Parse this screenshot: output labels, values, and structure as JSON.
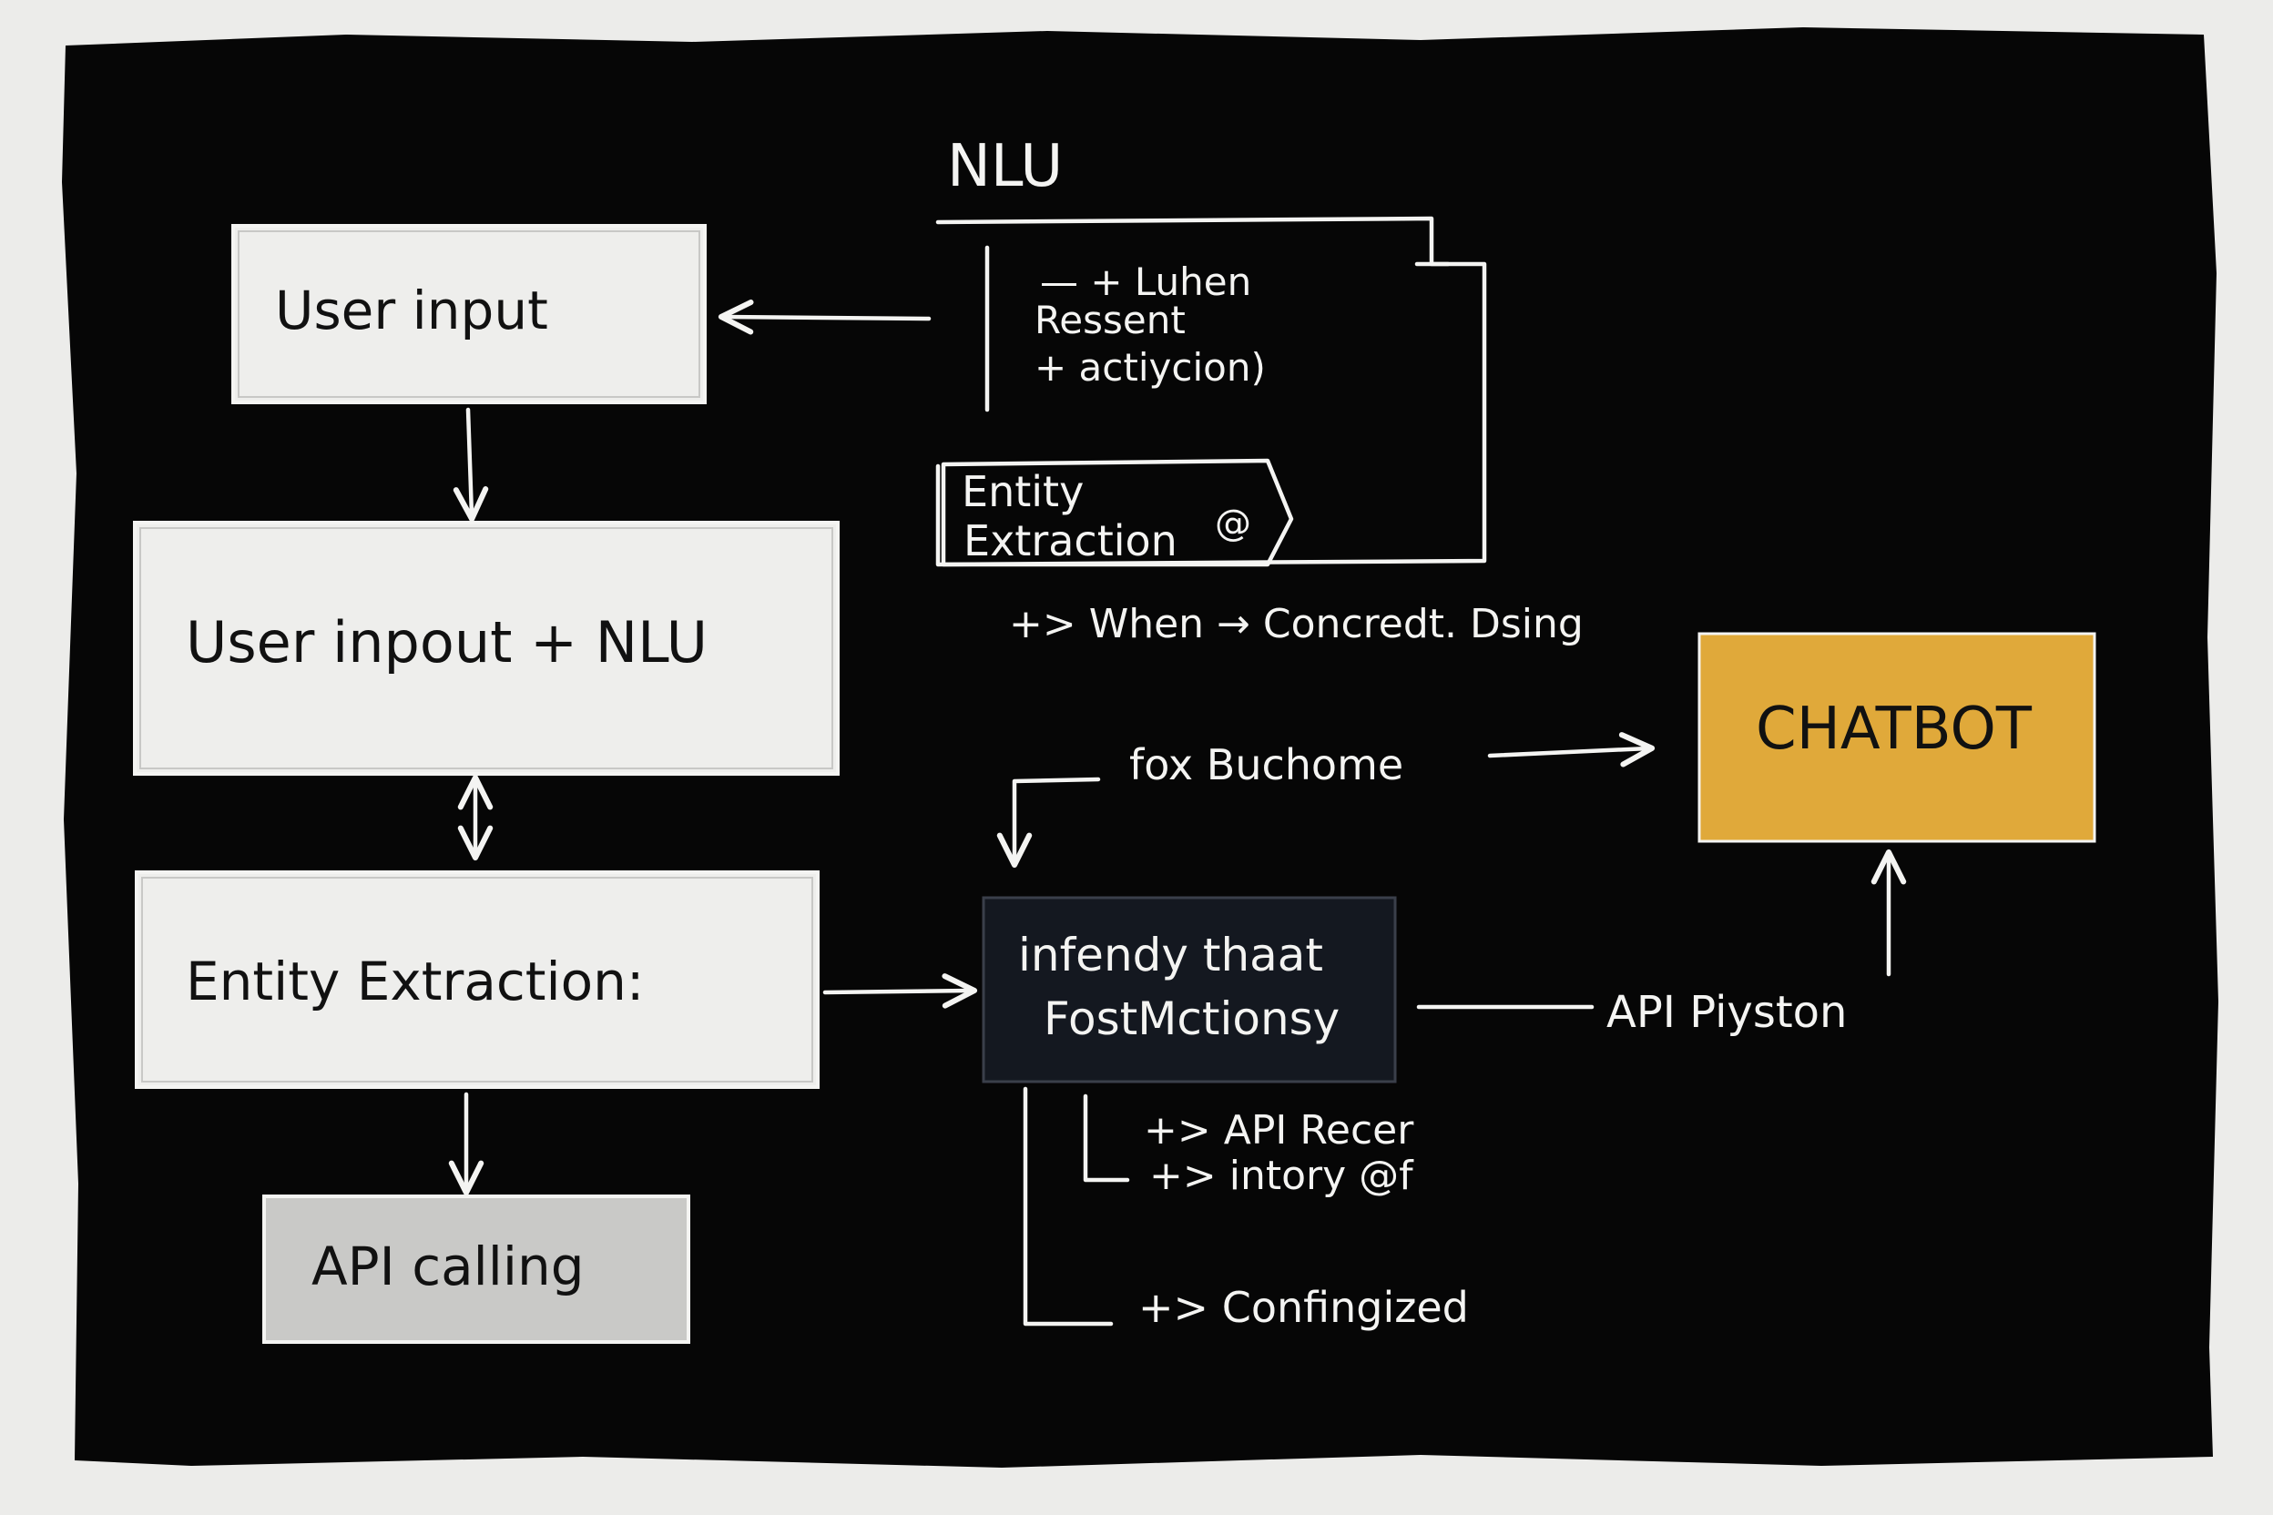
{
  "colors": {
    "board": "#060606",
    "paper": "#ececea",
    "chalk": "#f4f4f2",
    "box_light": "#eeeeec",
    "box_grey": "#c9c9c7",
    "box_dark": "#141820",
    "accent_gold": "#e0a93a"
  },
  "flow": {
    "user_input": "User input",
    "user_input_nlu": "User inpout + NLU",
    "entity_extraction": "Entity Extraction:",
    "api_calling": "API calling"
  },
  "nlu_panel": {
    "title": "NLU",
    "note_line1": "— + Luhen",
    "note_line2": "Ressent",
    "note_line3": "+ actiycion)",
    "entity_tag_line1": "Entity",
    "entity_tag_line2": "Extraction",
    "entity_tag_mark": "@",
    "when_line": "+> When → Concredt. Dsing"
  },
  "center": {
    "fox_label": "fox Buchome",
    "node_line1": "infendy thaat",
    "node_line2": "FostMctionsy",
    "api_label": "API Piyston",
    "branch1": "+> API Recer",
    "branch2": "+> intory @f",
    "branch3": "+> Confingized"
  },
  "chatbot": {
    "label": "CHATBOT"
  }
}
